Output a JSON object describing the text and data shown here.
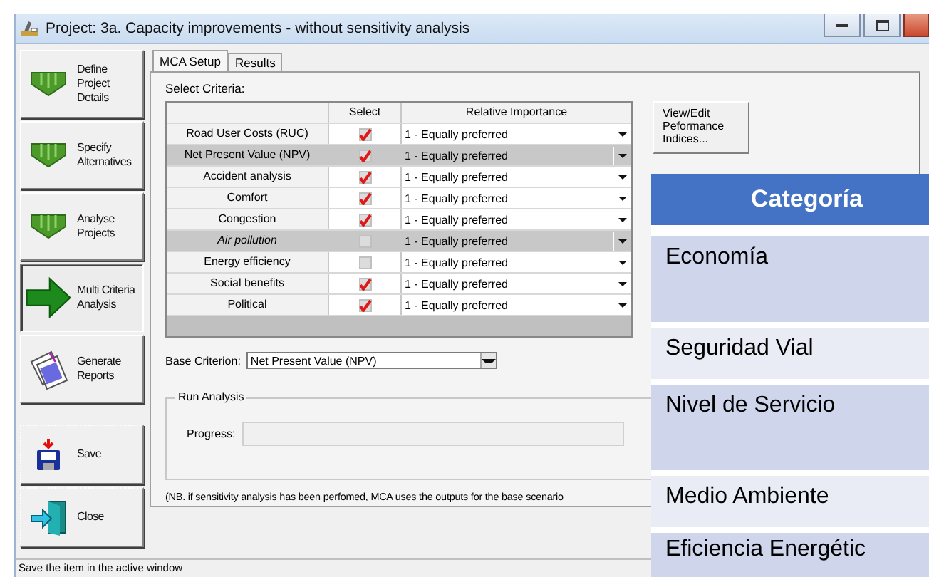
{
  "window": {
    "title": "Project: 3a. Capacity improvements - without sensitivity analysis"
  },
  "sidebar": {
    "items": [
      {
        "label": "Define Project Details",
        "kind": "down",
        "selected": false
      },
      {
        "label": "Specify Alternatives",
        "kind": "down",
        "selected": false
      },
      {
        "label": "Analyse Projects",
        "kind": "down",
        "selected": false
      },
      {
        "label": "Multi Criteria Analysis",
        "kind": "right",
        "selected": true
      },
      {
        "label": "Generate Reports",
        "kind": "reports",
        "selected": false
      }
    ]
  },
  "actions": [
    {
      "label": "Save",
      "kind": "save"
    },
    {
      "label": "Close",
      "kind": "close"
    }
  ],
  "tabs": [
    {
      "label": "MCA Setup",
      "selected": true
    },
    {
      "label": "Results",
      "selected": false
    }
  ],
  "criteria": {
    "label": "Select Criteria:",
    "columns": [
      "Select",
      "Relative Importance"
    ],
    "rows": [
      {
        "name": "Road User Costs (RUC)",
        "checked": true,
        "importance": "1 - Equally preferred",
        "highlighted": false,
        "italic": false
      },
      {
        "name": "Net Present Value (NPV)",
        "checked": true,
        "importance": "1 - Equally preferred",
        "highlighted": true,
        "italic": false
      },
      {
        "name": "Accident analysis",
        "checked": true,
        "importance": "1 - Equally preferred",
        "highlighted": false,
        "italic": false
      },
      {
        "name": "Comfort",
        "checked": true,
        "importance": "1 - Equally preferred",
        "highlighted": false,
        "italic": false
      },
      {
        "name": "Congestion",
        "checked": true,
        "importance": "1 - Equally preferred",
        "highlighted": false,
        "italic": false
      },
      {
        "name": "Air pollution",
        "checked": false,
        "importance": "1 - Equally preferred",
        "highlighted": true,
        "italic": true
      },
      {
        "name": "Energy efficiency",
        "checked": false,
        "importance": "1 - Equally preferred",
        "highlighted": false,
        "italic": false
      },
      {
        "name": "Social benefits",
        "checked": true,
        "importance": "1 - Equally preferred",
        "highlighted": false,
        "italic": false
      },
      {
        "name": "Political",
        "checked": true,
        "importance": "1 - Equally preferred",
        "highlighted": false,
        "italic": false
      }
    ]
  },
  "indices_button": "View/Edit\nPeformance\nIndices...",
  "base_criterion": {
    "label": "Base Criterion:",
    "value": "Net Present Value (NPV)"
  },
  "run_analysis": {
    "title": "Run Analysis",
    "progress_label": "Progress:"
  },
  "note": "(NB. if sensitivity analysis has been perfomed, MCA uses the outputs for the base scenario",
  "status_bar": "Save the item in the active window",
  "overlay_table": {
    "header": "Categoría",
    "rows": [
      {
        "label": "Economía",
        "kind": "tall"
      },
      {
        "label": "Seguridad Vial",
        "kind": "short"
      },
      {
        "label": "Nivel de Servicio",
        "kind": "tall"
      },
      {
        "label": "Medio Ambiente",
        "kind": "short"
      },
      {
        "label": "Eficiencia Energétic",
        "kind": "cut"
      }
    ]
  }
}
